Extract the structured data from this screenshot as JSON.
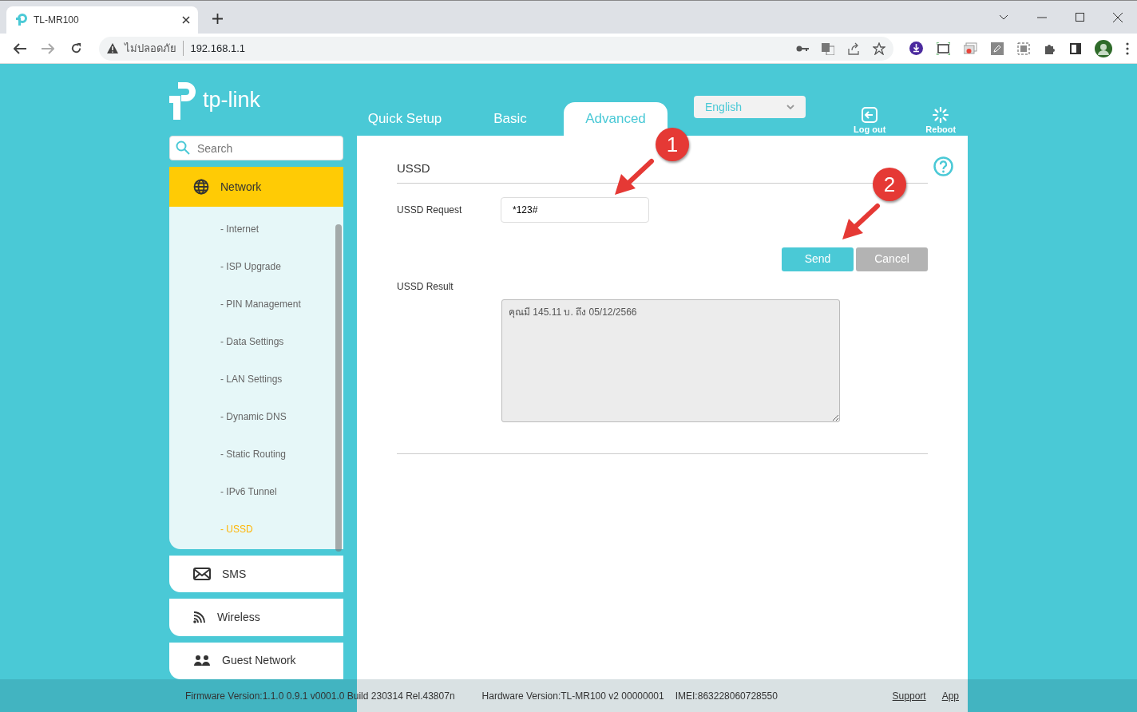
{
  "browser": {
    "tab_title": "TL-MR100",
    "security_label": "ไม่ปลอดภัย",
    "url": "192.168.1.1"
  },
  "header": {
    "logo": "tp-link",
    "nav_tabs": [
      {
        "label": "Quick Setup",
        "selected": false
      },
      {
        "label": "Basic",
        "selected": false
      },
      {
        "label": "Advanced",
        "selected": true
      }
    ],
    "language": "English",
    "actions": [
      {
        "label": "Log out",
        "kind": "logout"
      },
      {
        "label": "Reboot",
        "kind": "reboot"
      }
    ]
  },
  "sidebar": {
    "search": {
      "placeholder": "Search"
    },
    "menu": [
      {
        "label": "Network",
        "kind": "network",
        "selected": true,
        "expanded": true,
        "children": [
          {
            "label": "- Internet",
            "selected": false
          },
          {
            "label": "- ISP Upgrade",
            "selected": false
          },
          {
            "label": "- PIN Management",
            "selected": false
          },
          {
            "label": "- Data Settings",
            "selected": false
          },
          {
            "label": "- LAN Settings",
            "selected": false
          },
          {
            "label": "- Dynamic DNS",
            "selected": false
          },
          {
            "label": "- Static Routing",
            "selected": false
          },
          {
            "label": "- IPv6 Tunnel",
            "selected": false
          },
          {
            "label": "- USSD",
            "selected": true
          }
        ]
      },
      {
        "label": "SMS",
        "kind": "sms",
        "selected": false,
        "expanded": false
      },
      {
        "label": "Wireless",
        "kind": "wireless",
        "selected": false,
        "expanded": false
      },
      {
        "label": "Guest Network",
        "kind": "guest",
        "selected": false,
        "expanded": false
      }
    ]
  },
  "panel": {
    "title": "USSD",
    "request_label": "USSD Request",
    "request_value": "*123#",
    "buttons": [
      {
        "label": "Send",
        "kind": "primary"
      },
      {
        "label": "Cancel",
        "kind": "secondary"
      }
    ],
    "result_label": "USSD Result",
    "result_text": "คุณมี 145.11 บ. ถึง 05/12/2566"
  },
  "annotations": [
    {
      "label": "1"
    },
    {
      "label": "2"
    }
  ],
  "footer": {
    "firmware": "Firmware Version:1.1.0 0.9.1 v0001.0 Build 230314 Rel.43807n",
    "hardware": "Hardware Version:TL-MR100 v2 00000001",
    "imei": "IMEI:863228060728550",
    "links": [
      "Support",
      "App"
    ]
  }
}
